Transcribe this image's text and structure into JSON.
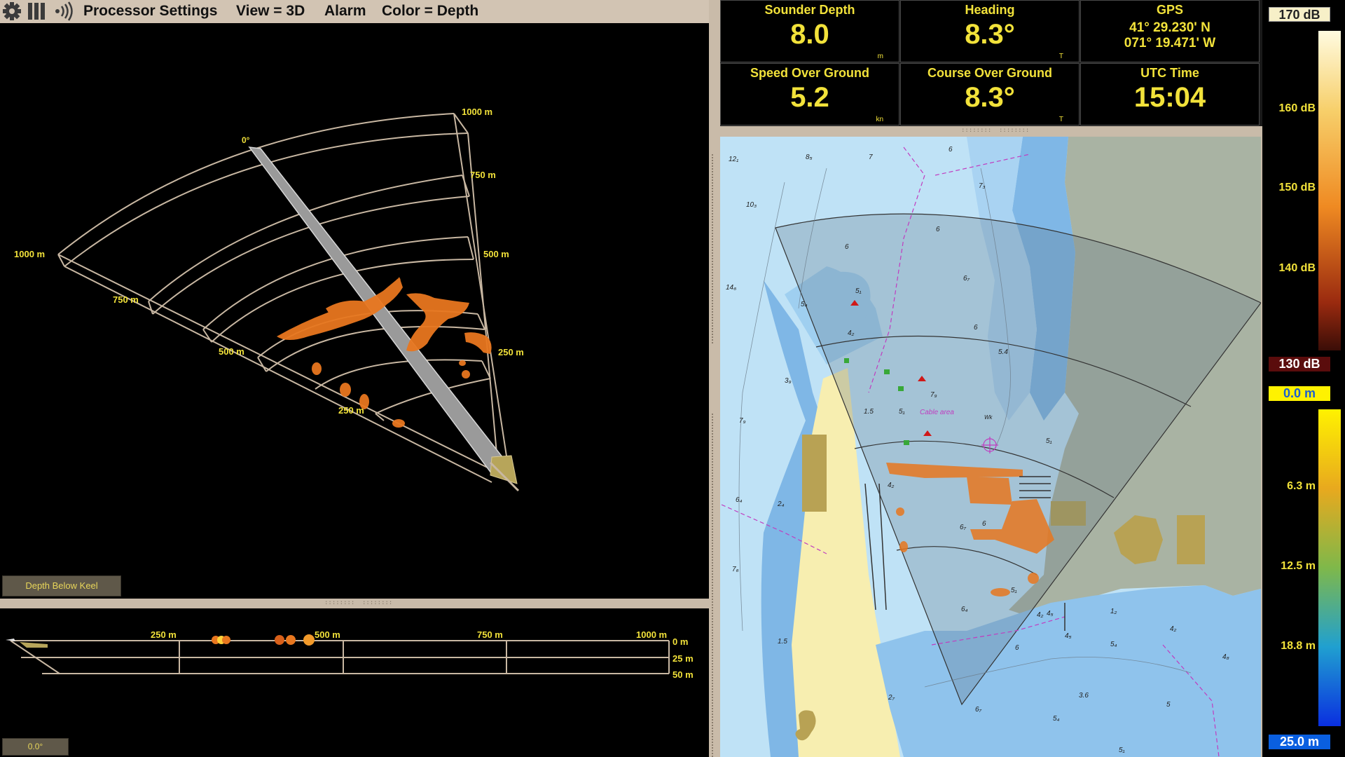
{
  "menubar": {
    "processor_settings": "Processor Settings",
    "view": "View = 3D",
    "alarm": "Alarm",
    "color": "Color = Depth"
  },
  "view3d": {
    "heading_label": "0°",
    "range_labels_right": [
      "1000 m",
      "750 m",
      "500 m",
      "250 m"
    ],
    "range_labels_left": [
      "1000 m",
      "750 m",
      "500 m",
      "250 m"
    ],
    "depth_below_keel_button": "Depth Below Keel"
  },
  "side_view": {
    "range_labels": [
      "250 m",
      "500 m",
      "750 m",
      "1000 m"
    ],
    "depth_labels": [
      "0 m",
      "25 m",
      "50 m"
    ],
    "tilt_readout": "0.0°"
  },
  "instruments": {
    "sounder_depth": {
      "title": "Sounder Depth",
      "value": "8.0",
      "unit": "m"
    },
    "heading": {
      "title": "Heading",
      "value": "8.3°",
      "unit": "T"
    },
    "gps": {
      "title": "GPS",
      "lat": "41° 29.230' N",
      "lon": "071° 19.471' W"
    },
    "sog": {
      "title": "Speed Over Ground",
      "value": "5.2",
      "unit": "kn"
    },
    "cog": {
      "title": "Course Over Ground",
      "value": "8.3°",
      "unit": "T"
    },
    "utc": {
      "title": "UTC Time",
      "value": "15:04"
    }
  },
  "chart": {
    "soundings": [
      "12₁",
      "8₅",
      "7",
      "6",
      "7₃",
      "10₃",
      "6",
      "6",
      "14₆",
      "5₄",
      "5₁",
      "4₂",
      "6₇",
      "6",
      "5.4",
      "3₉",
      "7₉",
      "1.5",
      "5₁",
      "7₉",
      "5₁",
      "6₄",
      "2₄",
      "4₂",
      "6₇",
      "6",
      "7₆",
      "1.5",
      "6₄",
      "5₁",
      "4₂",
      "1₂",
      "5₄",
      "4₈",
      "4₅",
      "4₅",
      "2₇",
      "6₇",
      "5₄",
      "5₁",
      "4₂",
      "6",
      "5",
      "3.6"
    ],
    "cable_area_label": "Cable area",
    "wreck_label": "Wk"
  },
  "scale_bar": {
    "db_top": "170 dB",
    "db_labels": [
      "160 dB",
      "150 dB",
      "140 dB"
    ],
    "db_bottom": "130 dB",
    "depth_top": "0.0 m",
    "depth_labels": [
      "6.3 m",
      "12.5 m",
      "18.8 m"
    ],
    "depth_bottom": "25.0 m"
  },
  "colors": {
    "ui_tan": "#d2c4b3",
    "label_yellow": "#f2e23a",
    "echo_orange": "#e8771f",
    "deep_water": "#7fb7e6",
    "shallow_water": "#bfe2f6",
    "land": "#a9b3a3",
    "sand": "#f7eeb0"
  }
}
